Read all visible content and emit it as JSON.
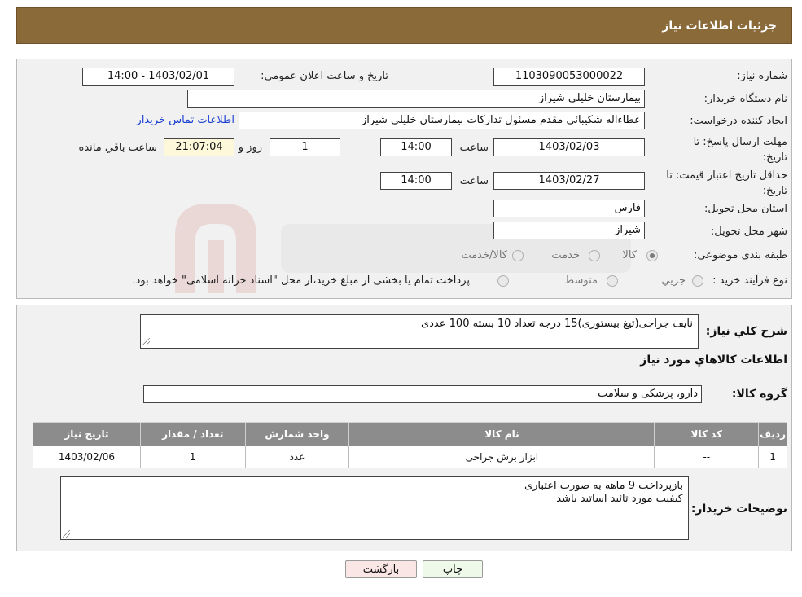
{
  "header": {
    "title": "جزئیات اطلاعات نیاز"
  },
  "form": {
    "need_number_label": "شماره نیاز:",
    "need_number": "1103090053000022",
    "announce_label": "تاریخ و ساعت اعلان عمومی:",
    "announce_value": "1403/02/01 - 14:00",
    "buyer_org_label": "نام دستگاه خریدار:",
    "buyer_org": "بیمارستان خلیلی شیراز",
    "creator_label": "ایجاد کننده درخواست:",
    "creator": "عطاءاله شکیبائی مقدم مسئول تدارکات  بیمارستان خلیلی شیراز",
    "contact_link": "اطلاعات تماس خریدار",
    "deadline_label_1": "مهلت ارسال پاسخ: تا",
    "deadline_label_2": "تاریخ:",
    "deadline_date": "1403/02/03",
    "time_label": "ساعت",
    "deadline_time": "14:00",
    "days_value": "1",
    "days_label": "روز و",
    "remaining_time": "21:07:04",
    "remaining_label": "ساعت باقي مانده",
    "validity_label_1": "حداقل تاریخ اعتبار قیمت: تا",
    "validity_label_2": "تاریخ:",
    "validity_date": "1403/02/27",
    "validity_time": "14:00",
    "province_label": "استان محل تحویل:",
    "province": "فارس",
    "city_label": "شهر محل تحویل:",
    "city": "شیراز",
    "category_label": "طبقه بندی موضوعی:",
    "category_options": [
      "کالا",
      "خدمت",
      "کالا/خدمت"
    ],
    "category_selected": "کالا",
    "process_label": "نوع فرآیند خرید :",
    "process_options": [
      "جزیي",
      "متوسط"
    ],
    "process_note": "پرداخت تمام یا بخشی از مبلغ خرید،از محل \"اسناد خزانه اسلامی\" خواهد بود."
  },
  "details": {
    "summary_label": "شرح کلي نیاز:",
    "summary": "نایف جراحی(تیغ بیستوری)15 درجه تعداد 10 بسته 100 عددی",
    "goods_info_title": "اطلاعات کالاهاي مورد نیاز",
    "group_label": "گروه کالا:",
    "group_value": "دارو، پزشکی و سلامت",
    "table": {
      "columns": [
        "ردیف",
        "کد کالا",
        "نام کالا",
        "واحد شمارش",
        "تعداد / مقدار",
        "تاریخ نیاز"
      ],
      "rows": [
        [
          "1",
          "--",
          "ابزار برش جراحی",
          "عدد",
          "1",
          "1403/02/06"
        ]
      ]
    },
    "buyer_notes_label": "توضیحات خریدار:",
    "buyer_notes": "بازپرداخت 9 ماهه  به صورت اعتباری\nکیفیت مورد تائید اساتید باشد"
  },
  "buttons": {
    "print": "چاپ",
    "back": "بازگشت"
  },
  "colors": {
    "header_bg": "#8b6a3a",
    "table_header_bg": "#8c8c8c",
    "link": "#1a3fd1"
  }
}
